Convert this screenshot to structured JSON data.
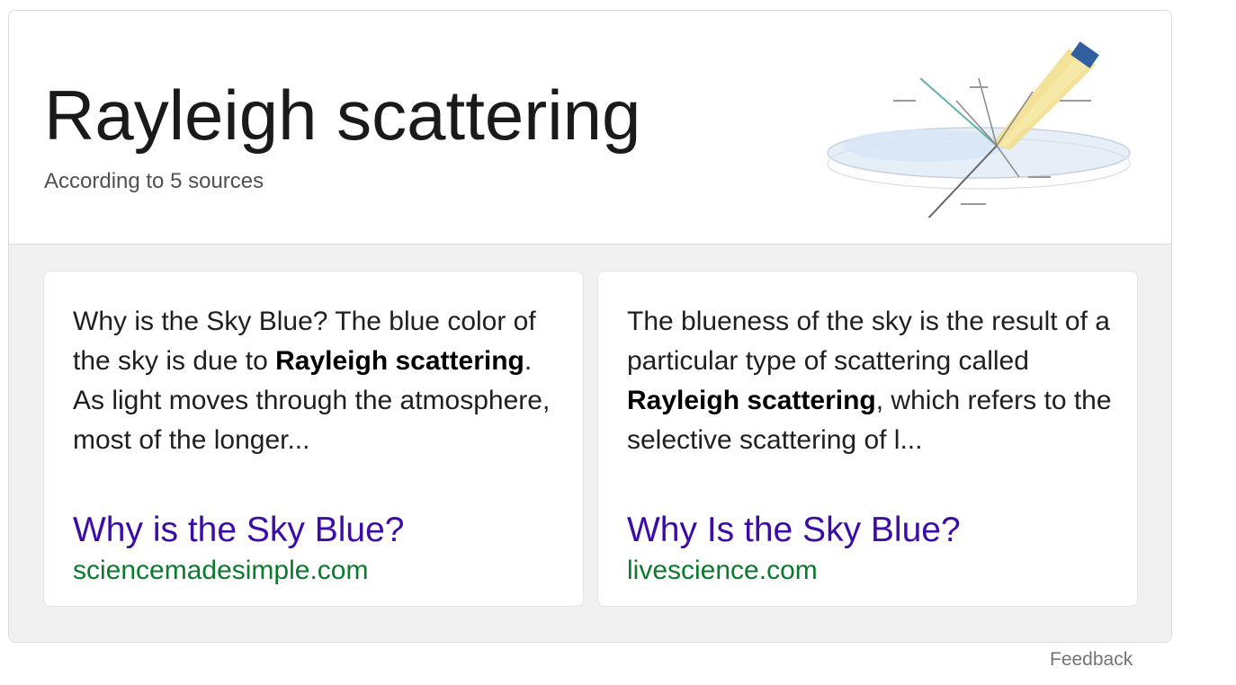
{
  "panel": {
    "title": "Rayleigh scattering",
    "subtitle": "According to 5 sources",
    "image_alt": "Rayleigh scattering diagram"
  },
  "cards": [
    {
      "snippet_parts": [
        {
          "text": "Why is the Sky Blue? The blue color of the sky is due to ",
          "bold": false
        },
        {
          "text": "Rayleigh scattering",
          "bold": true
        },
        {
          "text": ". As light moves through the atmosphere, most of the longer...",
          "bold": false
        }
      ],
      "link_title": "Why is the Sky Blue?",
      "domain": "sciencemadesimple.com"
    },
    {
      "snippet_parts": [
        {
          "text": "The blueness of the sky is the result of a particular type of scattering called ",
          "bold": false
        },
        {
          "text": "Rayleigh scattering",
          "bold": true
        },
        {
          "text": ", which refers to the selective scattering of l...",
          "bold": false
        }
      ],
      "link_title": "Why Is the Sky Blue?",
      "domain": "livescience.com"
    }
  ],
  "feedback_label": "Feedback",
  "colors": {
    "link": "#3c0ca8",
    "domain": "#0b7a2d",
    "panel_bg": "#f1f1f1"
  }
}
